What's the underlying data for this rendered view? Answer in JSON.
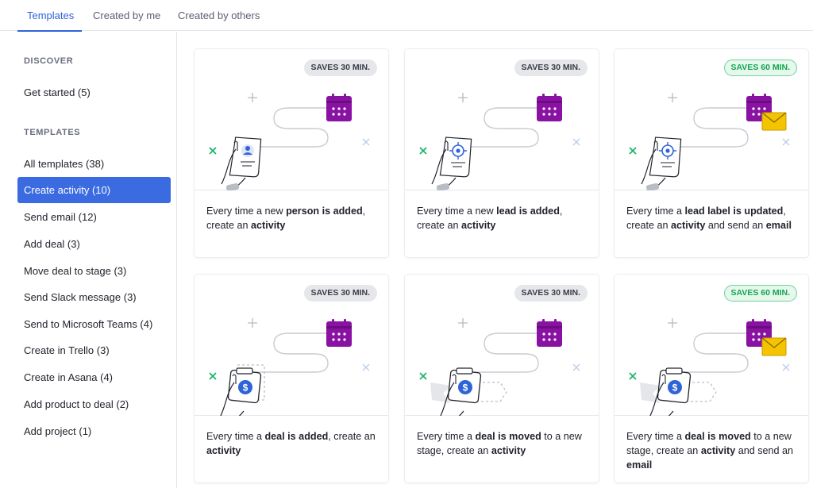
{
  "tabs": [
    {
      "label": "Templates",
      "active": true
    },
    {
      "label": "Created by me",
      "active": false
    },
    {
      "label": "Created by others",
      "active": false
    }
  ],
  "sidebar": {
    "discover_heading": "DISCOVER",
    "discover_items": [
      {
        "label": "Get started (5)"
      }
    ],
    "templates_heading": "TEMPLATES",
    "template_items": [
      {
        "label": "All templates (38)",
        "active": false
      },
      {
        "label": "Create activity (10)",
        "active": true
      },
      {
        "label": "Send email (12)",
        "active": false
      },
      {
        "label": "Add deal (3)",
        "active": false
      },
      {
        "label": "Move deal to stage (3)",
        "active": false
      },
      {
        "label": "Send Slack message (3)",
        "active": false
      },
      {
        "label": "Send to Microsoft Teams (4)",
        "active": false
      },
      {
        "label": "Create in Trello (3)",
        "active": false
      },
      {
        "label": "Create in Asana (4)",
        "active": false
      },
      {
        "label": "Add product to deal (2)",
        "active": false
      },
      {
        "label": "Add project (1)",
        "active": false
      }
    ]
  },
  "cards": [
    {
      "badge": "SAVES 30 MIN.",
      "badge_style": "gray",
      "trigger_icon": "person-document-icon",
      "action_icons": [
        "calendar-icon"
      ],
      "description": [
        {
          "t": "Every time a new "
        },
        {
          "t": "person is added",
          "b": true
        },
        {
          "t": ", create an "
        },
        {
          "t": "activity",
          "b": true
        }
      ]
    },
    {
      "badge": "SAVES 30 MIN.",
      "badge_style": "gray",
      "trigger_icon": "lead-target-icon",
      "action_icons": [
        "calendar-icon"
      ],
      "description": [
        {
          "t": "Every time a new "
        },
        {
          "t": "lead is added",
          "b": true
        },
        {
          "t": ", create an "
        },
        {
          "t": "activity",
          "b": true
        }
      ]
    },
    {
      "badge": "SAVES 60 MIN.",
      "badge_style": "green",
      "trigger_icon": "lead-target-icon",
      "action_icons": [
        "calendar-icon",
        "envelope-icon"
      ],
      "description": [
        {
          "t": "Every time a "
        },
        {
          "t": "lead label is updated",
          "b": true
        },
        {
          "t": ", create an "
        },
        {
          "t": "activity",
          "b": true
        },
        {
          "t": " and send an "
        },
        {
          "t": "email",
          "b": true
        }
      ]
    },
    {
      "badge": "SAVES 30 MIN.",
      "badge_style": "gray",
      "trigger_icon": "deal-dollar-icon",
      "action_icons": [
        "calendar-icon"
      ],
      "description": [
        {
          "t": "Every time a "
        },
        {
          "t": "deal is added",
          "b": true
        },
        {
          "t": ", create an "
        },
        {
          "t": "activity",
          "b": true
        }
      ]
    },
    {
      "badge": "SAVES 30 MIN.",
      "badge_style": "gray",
      "trigger_icon": "deal-moved-icon",
      "action_icons": [
        "calendar-icon"
      ],
      "description": [
        {
          "t": "Every time a "
        },
        {
          "t": "deal is moved",
          "b": true
        },
        {
          "t": " to a new stage, create an "
        },
        {
          "t": "activity",
          "b": true
        }
      ]
    },
    {
      "badge": "SAVES 60 MIN.",
      "badge_style": "green",
      "trigger_icon": "deal-moved-icon",
      "action_icons": [
        "calendar-icon",
        "envelope-icon"
      ],
      "description": [
        {
          "t": "Every time a "
        },
        {
          "t": "deal is moved",
          "b": true
        },
        {
          "t": " to a new stage, create an "
        },
        {
          "t": "activity",
          "b": true
        },
        {
          "t": " and send an "
        },
        {
          "t": "email",
          "b": true
        }
      ]
    }
  ],
  "colors": {
    "accent": "#2f63d8",
    "active_item_bg": "#3a6be0",
    "calendar": "#8a12a3",
    "envelope": "#f5c400",
    "dollar": "#2f63d8",
    "badge_green": "#13a552"
  }
}
